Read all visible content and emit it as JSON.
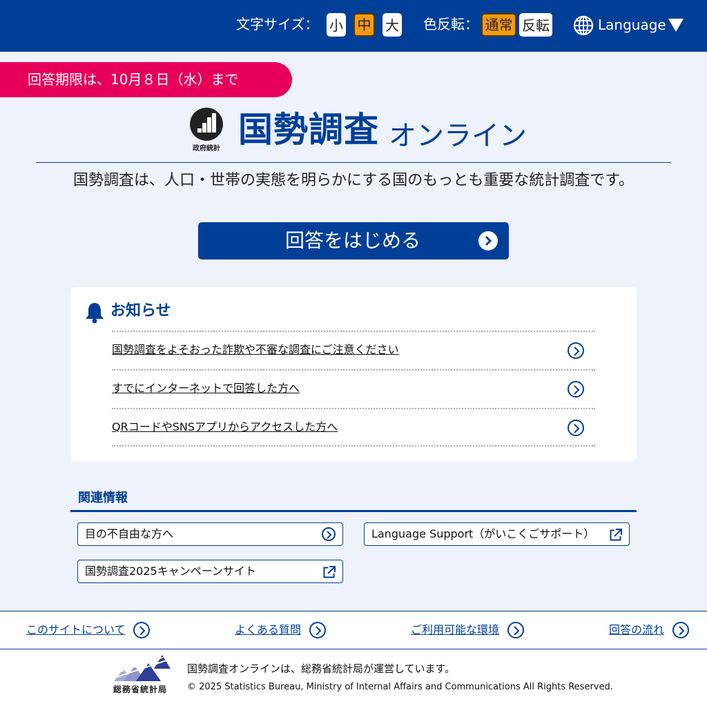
{
  "header": {
    "font_size_label": "文字サイズ：",
    "font_sizes": [
      "小",
      "中",
      "大"
    ],
    "font_size_selected": "中",
    "color_invert_label": "色反転：",
    "color_modes": [
      "通常",
      "反転"
    ],
    "color_mode_selected": "通常",
    "language_label": "Language",
    "colors": {
      "bar": "#003f98",
      "active": "#f39a12"
    }
  },
  "deadline": {
    "text": "回答期限は、10月８日（水）まで",
    "color": "#e6005a"
  },
  "logo": {
    "mark_caption": "政府統計",
    "title": "国勢調査",
    "subtitle": "オンライン"
  },
  "tagline": "国勢調査は、人口・世帯の実態を明らかにする国のもっとも重要な統計調査です。",
  "start_button": {
    "label": "回答をはじめる"
  },
  "notice": {
    "title": "お知らせ",
    "items": [
      "国勢調査をよそおった詐欺や不審な調査にご注意ください",
      "すでにインターネットで回答した方へ",
      "QRコードやSNSアプリからアクセスした方へ"
    ]
  },
  "related": {
    "title": "関連情報",
    "links": [
      {
        "label": "目の不自由な方へ",
        "icon": "chevron-right-circle-icon"
      },
      {
        "label": "Language Support（がいこくごサポート）",
        "icon": "external-link-icon"
      },
      {
        "label": "国勢調査2025キャンペーンサイト",
        "icon": "external-link-icon"
      }
    ]
  },
  "footer_nav": [
    "このサイトについて",
    "よくある質問",
    "ご利用可能な環境",
    "回答の流れ"
  ],
  "footer": {
    "bureau_name": "総務省統計局",
    "operated_by": "国勢調査オンラインは、総務省統計局が運営しています。",
    "copyright": "© 2025 Statistics Bureau, Ministry of Internal Affairs and Communications All Rights Reserved."
  }
}
